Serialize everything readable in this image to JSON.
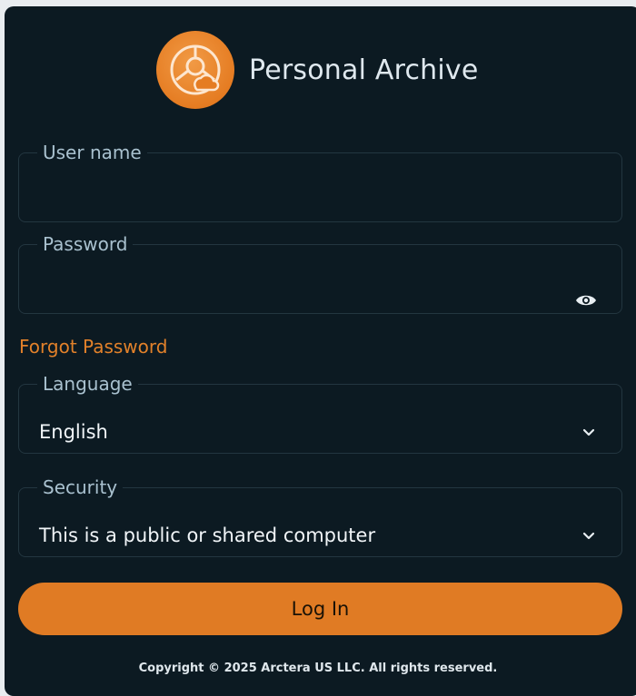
{
  "app": {
    "title": "Personal Archive",
    "logo_icon": "archive-compass-icon",
    "accent_color": "#e07b24"
  },
  "form": {
    "username": {
      "label": "User name",
      "value": "",
      "placeholder": ""
    },
    "password": {
      "label": "Password",
      "value": "",
      "placeholder": "",
      "toggle_icon": "eye-icon"
    },
    "forgot_password_label": "Forgot Password",
    "language": {
      "label": "Language",
      "selected": "English",
      "icon": "chevron-down-icon"
    },
    "security": {
      "label": "Security",
      "selected": "This is a public or shared computer",
      "icon": "chevron-down-icon"
    },
    "login_label": "Log In"
  },
  "footer": {
    "copyright": "Copyright © 2025 Arctera US LLC. All rights reserved."
  }
}
